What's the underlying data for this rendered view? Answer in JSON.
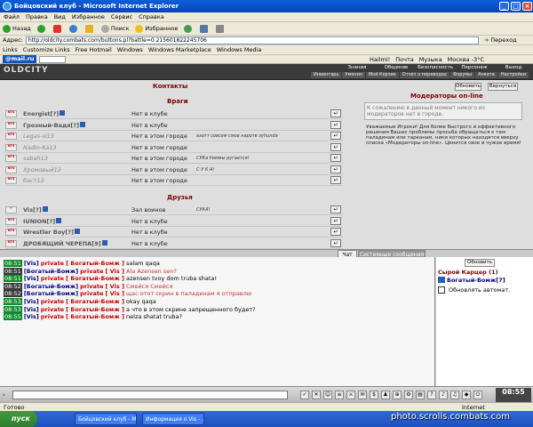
{
  "window": {
    "title": "Бойцовский клуб - Microsoft Internet Explorer"
  },
  "menu": [
    "Файл",
    "Правка",
    "Вид",
    "Избранное",
    "Сервис",
    "Справка"
  ],
  "toolbar": {
    "back": "Назад",
    "search": "Поиск",
    "favorites": "Избранное"
  },
  "address": {
    "label": "Адрес:",
    "value": "http://oldcity.combats.com/buttons.pl?battle=0.215601822245706",
    "go": "Переход"
  },
  "links": {
    "label": "Links",
    "items": [
      "Customize Links",
      "Free Hotmail",
      "Windows",
      "Windows Marketplace",
      "Windows Media"
    ]
  },
  "mailbar": {
    "logo": "@mail.ru",
    "user": "Hailmi!",
    "mail": "Почта",
    "music": "Музыка",
    "weather": "Москва -3°C"
  },
  "game": {
    "logo": "OLDCITY",
    "topnav": [
      "Знания",
      "Общение",
      "Безопасность",
      "Персонаж",
      "Выход"
    ],
    "subnav": [
      "Инвентарь",
      "Умения",
      "Мой Корзик",
      "Отчет о переводах",
      "Форумы",
      "Анкета",
      "Настройки"
    ]
  },
  "contacts": {
    "title": "Контакты",
    "refresh": "Обновить",
    "back": "Вернуться",
    "enemies_title": "Враги",
    "friends_title": "Друзья",
    "enemies": [
      {
        "flag": "NTS",
        "nick": "Energist",
        "lvl": "[?]",
        "loc": "Нет в клубе",
        "note": "",
        "gray": false
      },
      {
        "flag": "NTS",
        "nick": "Грозный-Вадя",
        "lvl": "[?]",
        "loc": "Нет в клубе",
        "note": "",
        "gray": false
      },
      {
        "flag": "NTS",
        "nick": "Legas-si",
        "lvl": "13",
        "loc": "Нет в этом городе",
        "note": "азатт совсем смов наротв зуhunda",
        "gray": true
      },
      {
        "flag": "NTS",
        "nick": "Nadin-Ka",
        "lvl": "13",
        "loc": "Нет в этом городе",
        "note": "",
        "gray": true
      },
      {
        "flag": "NTS",
        "nick": "sabah",
        "lvl": "13",
        "loc": "Нет в этом городе",
        "note": "СУКа Уиммы ругается!",
        "gray": true
      },
      {
        "flag": "NTS",
        "nick": "Хромовый",
        "lvl": "13",
        "loc": "Нет в этом городе",
        "note": "С У К А!",
        "gray": true
      },
      {
        "flag": "NTS",
        "nick": "баст",
        "lvl": "13",
        "loc": "Нет в этом городе",
        "note": "",
        "gray": true
      }
    ],
    "friends": [
      {
        "flag": "✦",
        "nick": "Vis",
        "lvl": "[?]",
        "loc": "Зал воинов",
        "note": "СУКА!",
        "gray": false
      },
      {
        "flag": "NTS",
        "nick": "IUNION",
        "lvl": "[?]",
        "loc": "Нет в клубе",
        "note": "",
        "gray": false
      },
      {
        "flag": "NTS",
        "nick": "Wrestler Boy",
        "lvl": "[?]",
        "loc": "Нет в клубе",
        "note": "",
        "gray": false
      },
      {
        "flag": "NTS",
        "nick": "ДРОБЯЩИЙ ЧЕРЕПА",
        "lvl": "[9]",
        "loc": "Нет в клубе",
        "note": "",
        "gray": false
      }
    ],
    "moderators_title": "Модераторы on-line",
    "moderators_empty": "К сожалению в данный момент никого из модераторов нет в городе.",
    "moderators_note": "Уважаемые Игроки! Для более быстрого и эффективного решения Ваших проблемы просьба обращаться к тем паладинам или тарканам, ники которых находятся вверху списка «Модераторы on-line». Ценится свое и чужое время!"
  },
  "tabs": {
    "chat": "Чат",
    "system": "Системные сообщения"
  },
  "chat": [
    {
      "time": "08:51",
      "from": "[Vis]",
      "priv": "private",
      "to": "[ Богатый-Бомж ]",
      "text": "salam qaqa",
      "green": true
    },
    {
      "time": "08:51",
      "from": "[Богатый-Бомж]",
      "priv": "private",
      "to": "[ Vis ]",
      "text": "Ala Azensen sen?",
      "green": false
    },
    {
      "time": "08:51",
      "from": "[Vis]",
      "priv": "private",
      "to": "[ Богатый-Бомж ]",
      "text": "azensen tvoy dom truba shata!",
      "green": true
    },
    {
      "time": "08:52",
      "from": "[Богатый-Бомж]",
      "priv": "private",
      "to": "[ Vis ]",
      "text": "Смейся Смейся",
      "green": false
    },
    {
      "time": "08:52",
      "from": "[Богатый-Бомж]",
      "priv": "private",
      "to": "[ Vis ]",
      "text": "щас отот скрин в паладинам я отправлю",
      "green": false
    },
    {
      "time": "08:53",
      "from": "[Vis]",
      "priv": "private",
      "to": "[ Богатый-Бомж ]",
      "text": "okay qaqa",
      "green": true
    },
    {
      "time": "08:53",
      "from": "[Vis]",
      "priv": "private",
      "to": "[ Богатый-Бомж ]",
      "text": "а что в этом скрине запрещенного будет?",
      "green": true
    },
    {
      "time": "08:55",
      "from": "[Vis]",
      "priv": "private",
      "to": "[ Богатый-Бомж ]",
      "text": "nelza shatat truba?",
      "green": true
    }
  ],
  "side": {
    "refresh": "Обновить",
    "room": "Сырой Карцер (1)",
    "user": "Богатый-Бомж[7]",
    "auto": "Обновлять автомат."
  },
  "clock": "08:55",
  "status": {
    "ready": "Готово",
    "zone": "Internet"
  },
  "taskbar": {
    "start": "пуск",
    "tasks": [
      "Бойцовский клуб - M...",
      "Информация о Vis - ..."
    ]
  },
  "watermark": "photo.scrolls.combats.com",
  "colors": {
    "accent": "#800000",
    "chat_time": "#0d8c2b",
    "private": "#cc0000"
  }
}
